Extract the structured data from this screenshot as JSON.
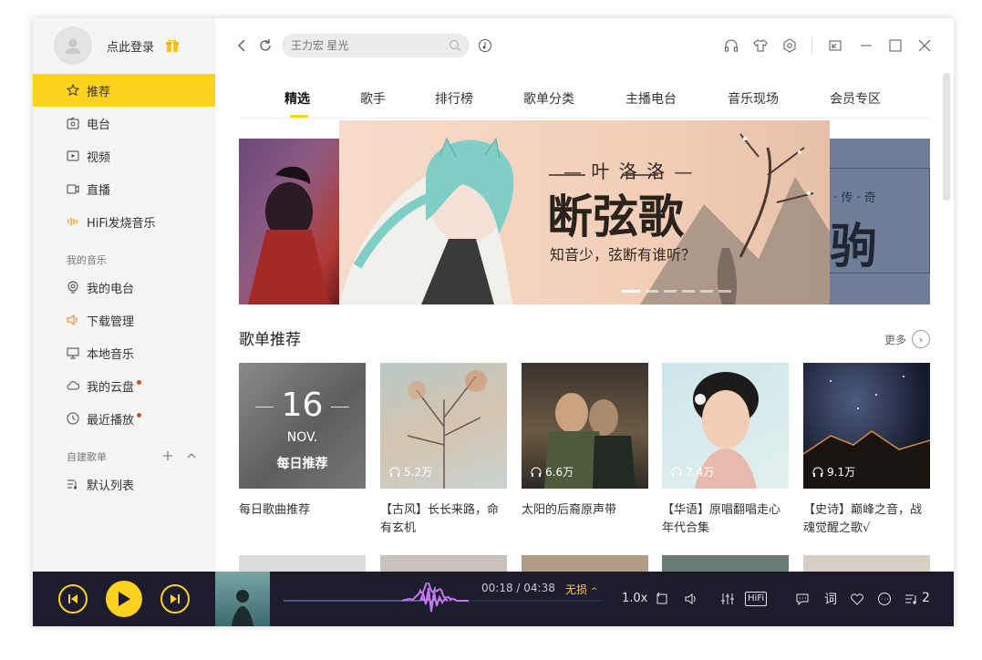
{
  "sidebar": {
    "login": "点此登录",
    "nav": [
      {
        "label": "推荐",
        "icon": "star-icon"
      },
      {
        "label": "电台",
        "icon": "radio-icon"
      },
      {
        "label": "视频",
        "icon": "video-icon"
      },
      {
        "label": "直播",
        "icon": "live-icon"
      },
      {
        "label": "HiFi发烧音乐",
        "icon": "hifi-wave-icon"
      }
    ],
    "my_music_title": "我的音乐",
    "my_music": [
      {
        "label": "我的电台",
        "icon": "podcast-icon"
      },
      {
        "label": "下载管理",
        "icon": "download-speaker-icon"
      },
      {
        "label": "本地音乐",
        "icon": "monitor-icon"
      },
      {
        "label": "我的云盘",
        "icon": "cloud-icon"
      },
      {
        "label": "最近播放",
        "icon": "clock-icon"
      }
    ],
    "playlists_title": "自建歌单",
    "playlists": [
      {
        "label": "默认列表",
        "icon": "playlist-icon"
      }
    ]
  },
  "topbar": {
    "search_placeholder": "王力宏 星光"
  },
  "tabs": [
    "精选",
    "歌手",
    "排行榜",
    "歌单分类",
    "主播电台",
    "音乐现场",
    "会员专区"
  ],
  "banner": {
    "artist": "— 叶 洛 洛 —",
    "title": "断弦歌",
    "subtitle": "知音少，弦断有谁听？",
    "right_text_small": "· 传 · 奇",
    "right_text_big": "驹"
  },
  "section": {
    "title": "歌单推荐",
    "more": "更多"
  },
  "cards": [
    {
      "title": "每日歌曲推荐",
      "date_num": "16",
      "month": "NOV.",
      "daily": "每日推荐",
      "plays": ""
    },
    {
      "title": "【古风】长长来路，命有玄机",
      "plays": "5.2万"
    },
    {
      "title": "太阳的后裔原声带",
      "plays": "6.6万"
    },
    {
      "title": "【华语】原唱翻唱走心年代合集",
      "plays": "7.4万"
    },
    {
      "title": "【史诗】巅峰之音，战魂觉醒之歌√",
      "plays": "9.1万"
    }
  ],
  "player": {
    "time": "00:18 / 04:38",
    "quality": "无损",
    "speed": "1.0x",
    "lyrics": "词",
    "queue_count": "2",
    "hifi": "HiFi"
  },
  "colors": {
    "accent": "#ffd21f",
    "player_bg": "#1c1c2c",
    "wave": "#c576f0"
  }
}
